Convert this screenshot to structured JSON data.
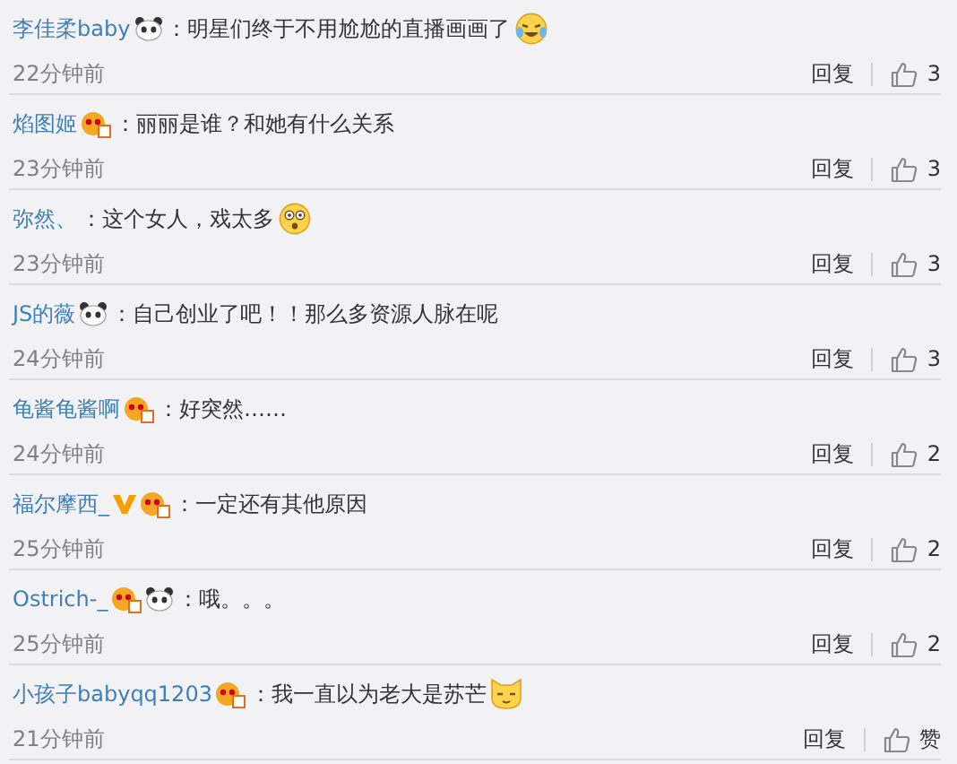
{
  "comments": [
    {
      "user": "李佳柔baby",
      "badges": [
        {
          "kind": "panda"
        }
      ],
      "text": "：明星们终于不用尬尬的直播画画了",
      "emoji": {
        "kind": "tears"
      },
      "time": "22分钟前",
      "reply": "回复",
      "likes": "3"
    },
    {
      "user": "焰图姬",
      "badges": [
        {
          "kind": "fan"
        }
      ],
      "text": "：丽丽是谁？和她有什么关系",
      "time": "23分钟前",
      "reply": "回复",
      "likes": "3"
    },
    {
      "user": "弥然、",
      "text": "：这个女人，戏太多",
      "emoji": {
        "kind": "shocked"
      },
      "time": "23分钟前",
      "reply": "回复",
      "likes": "3"
    },
    {
      "user": "JS的薇",
      "badges": [
        {
          "kind": "panda"
        }
      ],
      "text": "：自己创业了吧！！那么多资源人脉在呢",
      "time": "24分钟前",
      "reply": "回复",
      "likes": "3"
    },
    {
      "user": "龟酱龟酱啊",
      "badges": [
        {
          "kind": "fan"
        }
      ],
      "text": "：好突然……",
      "time": "24分钟前",
      "reply": "回复",
      "likes": "2"
    },
    {
      "user": "福尔摩西_",
      "badges": [
        {
          "kind": "vip"
        },
        {
          "kind": "fan"
        }
      ],
      "text": "：一定还有其他原因",
      "time": "25分钟前",
      "reply": "回复",
      "likes": "2"
    },
    {
      "user": "Ostrich-_",
      "badges": [
        {
          "kind": "fan"
        },
        {
          "kind": "panda"
        }
      ],
      "text": "：哦。。。",
      "time": "25分钟前",
      "reply": "回复",
      "likes": "2"
    },
    {
      "user": "小孩子babyqq1203",
      "badges": [
        {
          "kind": "fan"
        }
      ],
      "text": "：我一直以为老大是苏芒",
      "emoji": {
        "kind": "cat"
      },
      "time": "21分钟前",
      "reply": "回复",
      "likes": "赞"
    }
  ]
}
